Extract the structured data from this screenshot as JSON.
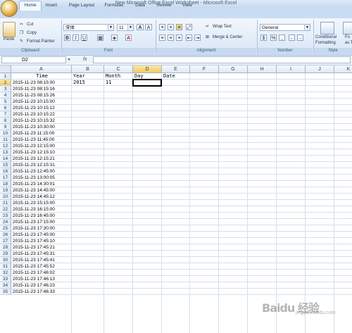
{
  "window": {
    "title": "New Microsoft Office Excel Worksheet - Microsoft Excel"
  },
  "tabs": [
    "Home",
    "Insert",
    "Page Layout",
    "Formulas",
    "Data",
    "Review",
    "View"
  ],
  "clipboard": {
    "paste": "Paste",
    "cut": "Cut",
    "copy": "Copy",
    "format_painter": "Format Painter",
    "label": "Clipboard"
  },
  "font": {
    "name": "宋体",
    "size": "11",
    "grow": "A",
    "shrink": "A",
    "label": "Font"
  },
  "alignment": {
    "wrap_text": "Wrap Text",
    "merge_center": "Merge & Center",
    "label": "Alignment"
  },
  "number": {
    "format": "General",
    "currency": "$",
    "percent": "%",
    "comma": ",",
    "label": "Number"
  },
  "styles": {
    "conditional_formatting_1": "Conditional",
    "conditional_formatting_2": "Formatting",
    "format_as_table_1": "Fo",
    "format_as_table_2": "as T",
    "label": "Style"
  },
  "formula_bar": {
    "name_box": "D2",
    "fx": "fx",
    "value": ""
  },
  "columns": [
    "A",
    "B",
    "C",
    "D",
    "E",
    "F",
    "G",
    "H",
    "I",
    "J",
    "K"
  ],
  "active_column": "D",
  "active_row": "2",
  "rows": [
    "1",
    "2",
    "3",
    "4",
    "5",
    "6",
    "7",
    "8",
    "9",
    "10",
    "11",
    "12",
    "13",
    "14",
    "15",
    "16",
    "17",
    "18",
    "19",
    "20",
    "21",
    "22",
    "23",
    "24",
    "25",
    "26",
    "27",
    "28",
    "29",
    "30",
    "31",
    "32",
    "33",
    "34",
    "35"
  ],
  "headers": {
    "A": "Time",
    "B": "Year",
    "C": "Month",
    "D": "Day",
    "E": "Date"
  },
  "row2": {
    "B": "2015",
    "C": "11"
  },
  "times": [
    "2015-11-23 08:15:00",
    "2015-11-23 08:15:16",
    "2015-11-23 08:15:26",
    "2015-11-23 10:15:00",
    "2015-11-23 10:15:12",
    "2015-11-23 10:15:22",
    "2015-11-23 10:15:32",
    "2015-11-23 10:30:00",
    "2015-11-23 11:15:00",
    "2015-11-23 11:45:00",
    "2015-11-23 12:15:00",
    "2015-11-23 12:15:10",
    "2015-11-23 12:15:21",
    "2015-11-23 12:15:31",
    "2015-11-23 12:45:00",
    "2015-11-23 13:00:05",
    "2015-11-23 14:30:01",
    "2015-11-23 14:45:00",
    "2015-11-23 14:45:12",
    "2015-11-23 15:15:00",
    "2015-11-23 16:15:00",
    "2015-11-23 16:45:00",
    "2015-11-23 17:15:00",
    "2015-11-23 17:30:00",
    "2015-11-23 17:45:00",
    "2015-11-23 17:45:10",
    "2015-11-23 17:45:21",
    "2015-11-23 17:45:31",
    "2015-11-23 17:45:41",
    "2015-11-23 17:45:52",
    "2015-11-23 17:46:02",
    "2015-11-23 17:46:13",
    "2015-11-23 17:46:23",
    "2015-11-23 17:46:33"
  ],
  "watermark": {
    "text": "Baidu 经验",
    "sub": "jingyan.baidu.com"
  },
  "colors": {
    "ribbon": "#d8e6f6",
    "tabs": "#c9dcf3",
    "active_header": "#f5c85e",
    "gridline": "#d5dfeb"
  }
}
